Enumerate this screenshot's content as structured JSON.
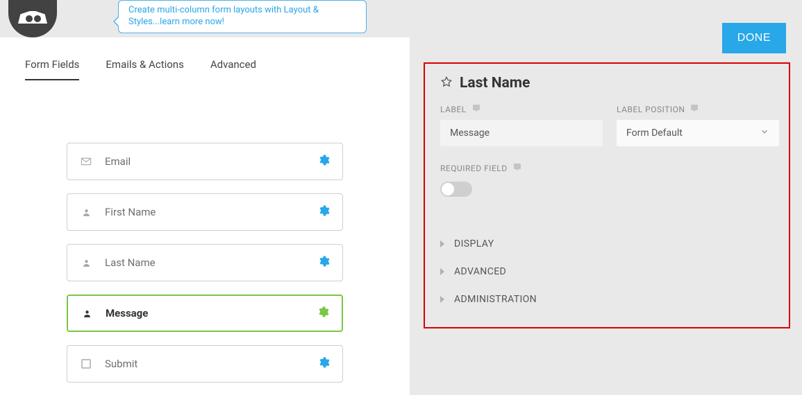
{
  "header": {
    "tip_text": "Create multi-column form layouts with Layout & Styles...learn more now!",
    "done_label": "DONE"
  },
  "tabs": [
    {
      "label": "Form Fields",
      "active": true
    },
    {
      "label": "Emails & Actions",
      "active": false
    },
    {
      "label": "Advanced",
      "active": false
    }
  ],
  "fields": [
    {
      "icon": "envelope",
      "label": "Email",
      "selected": false
    },
    {
      "icon": "user",
      "label": "First Name",
      "selected": false
    },
    {
      "icon": "user",
      "label": "Last Name",
      "selected": false
    },
    {
      "icon": "user",
      "label": "Message",
      "selected": true
    },
    {
      "icon": "square",
      "label": "Submit",
      "selected": false
    }
  ],
  "detail": {
    "title": "Last Name",
    "label_caption": "LABEL",
    "label_value": "Message",
    "position_caption": "LABEL POSITION",
    "position_value": "Form Default",
    "required_caption": "REQUIRED FIELD",
    "required_on": false,
    "sections": [
      {
        "label": "DISPLAY"
      },
      {
        "label": "ADVANCED"
      },
      {
        "label": "ADMINISTRATION"
      }
    ]
  }
}
